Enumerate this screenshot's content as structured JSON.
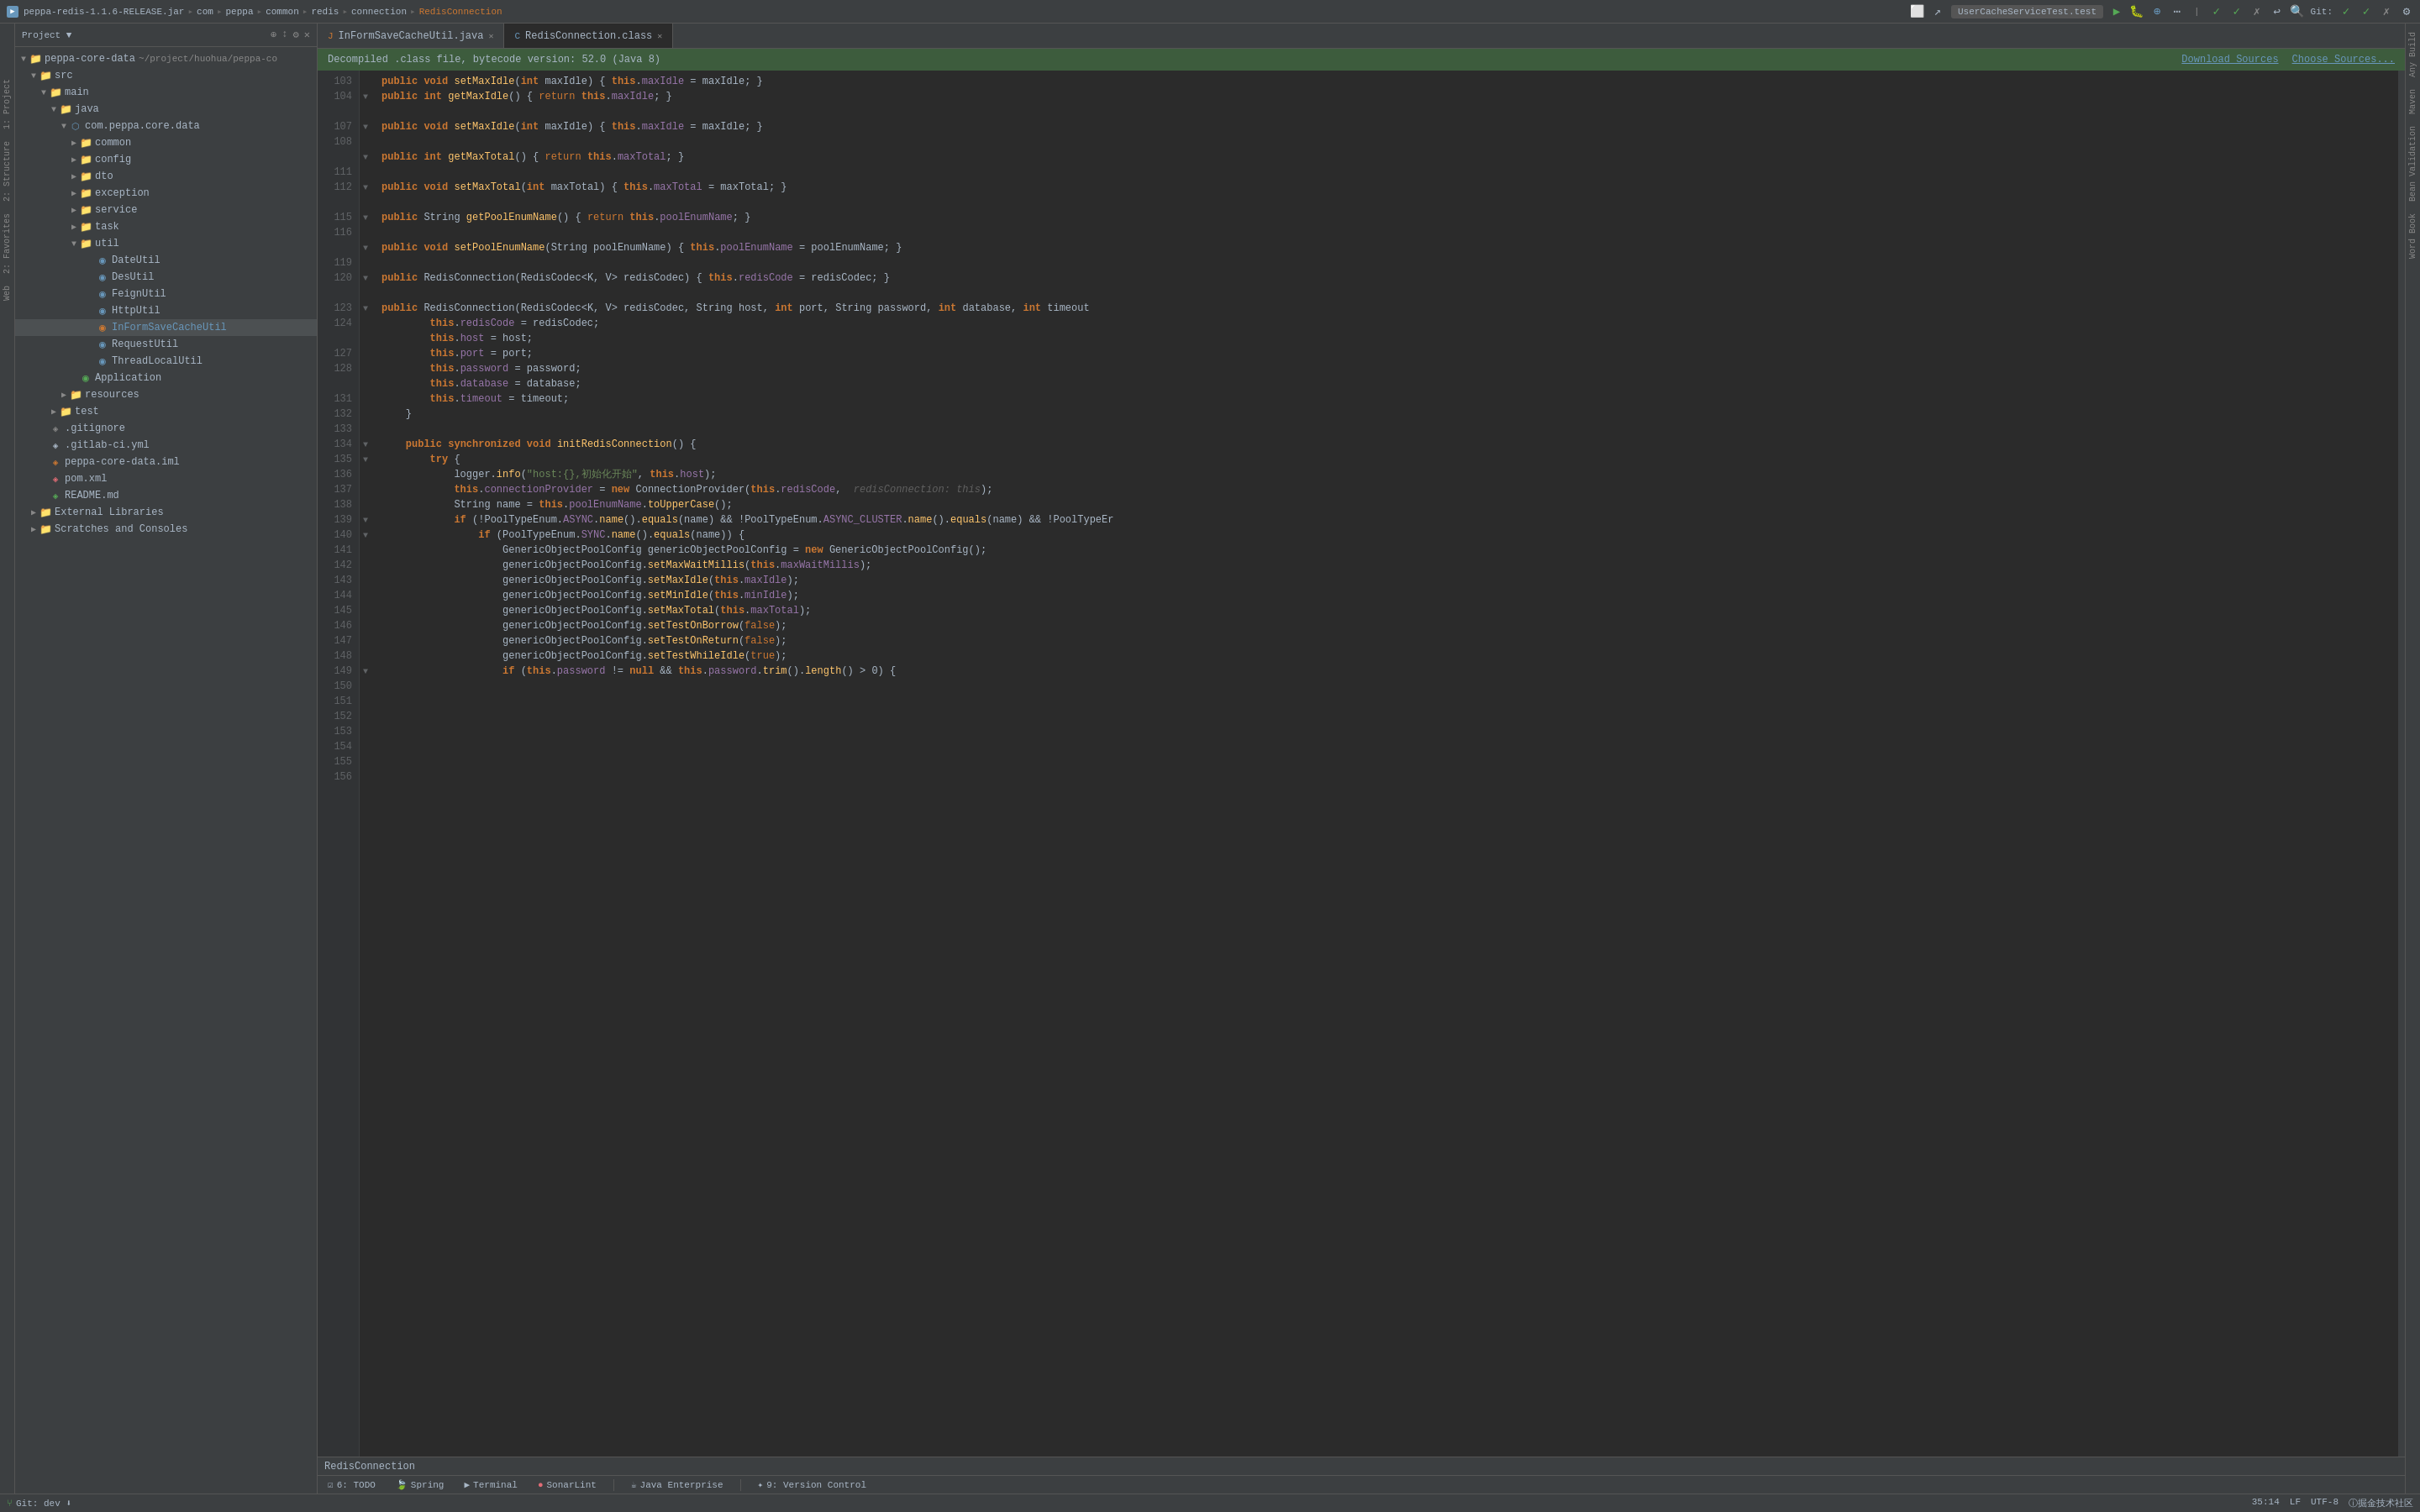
{
  "titleBar": {
    "icon": "▶",
    "breadcrumbs": [
      "peppa-redis-1.1.6-RELEASE.jar",
      "com",
      "peppa",
      "common",
      "redis",
      "connection",
      "RedisConnection"
    ],
    "runConfig": "UserCacheServiceTest.test",
    "git": "Git:"
  },
  "sidebar": {
    "title": "Project",
    "rootItem": "peppa-core-data",
    "rootPath": "~/project/huohua/peppa-co",
    "tree": [
      {
        "id": "peppa-core-data",
        "label": "peppa-core-data",
        "level": 0,
        "type": "project",
        "expanded": true,
        "arrow": "▼"
      },
      {
        "id": "src",
        "label": "src",
        "level": 1,
        "type": "folder-src",
        "expanded": true,
        "arrow": "▼"
      },
      {
        "id": "main",
        "label": "main",
        "level": 2,
        "type": "folder-main",
        "expanded": true,
        "arrow": "▼"
      },
      {
        "id": "java",
        "label": "java",
        "level": 3,
        "type": "folder",
        "expanded": true,
        "arrow": "▼"
      },
      {
        "id": "com.peppa.core.data",
        "label": "com.peppa.core.data",
        "level": 4,
        "type": "package",
        "expanded": true,
        "arrow": "▼"
      },
      {
        "id": "common",
        "label": "common",
        "level": 5,
        "type": "folder",
        "expanded": false,
        "arrow": "▶"
      },
      {
        "id": "config",
        "label": "config",
        "level": 5,
        "type": "folder",
        "expanded": false,
        "arrow": "▶"
      },
      {
        "id": "dto",
        "label": "dto",
        "level": 5,
        "type": "folder",
        "expanded": false,
        "arrow": "▶"
      },
      {
        "id": "exception",
        "label": "exception",
        "level": 5,
        "type": "folder",
        "expanded": false,
        "arrow": "▶"
      },
      {
        "id": "service",
        "label": "service",
        "level": 5,
        "type": "folder",
        "expanded": false,
        "arrow": "▶"
      },
      {
        "id": "task",
        "label": "task",
        "level": 5,
        "type": "folder",
        "expanded": false,
        "arrow": "▶"
      },
      {
        "id": "util",
        "label": "util",
        "level": 5,
        "type": "folder",
        "expanded": true,
        "arrow": "▼"
      },
      {
        "id": "DateUtil",
        "label": "DateUtil",
        "level": 6,
        "type": "class-java",
        "arrow": ""
      },
      {
        "id": "DesUtil",
        "label": "DesUtil",
        "level": 6,
        "type": "class-java",
        "arrow": ""
      },
      {
        "id": "FeignUtil",
        "label": "FeignUtil",
        "level": 6,
        "type": "class-java",
        "arrow": ""
      },
      {
        "id": "HttpUtil",
        "label": "HttpUtil",
        "level": 6,
        "type": "class-java",
        "arrow": ""
      },
      {
        "id": "InFormSaveCacheUtil",
        "label": "InFormSaveCacheUtil",
        "level": 6,
        "type": "class-active",
        "arrow": ""
      },
      {
        "id": "RequestUtil",
        "label": "RequestUtil",
        "level": 6,
        "type": "class-java",
        "arrow": ""
      },
      {
        "id": "ThreadLocalUtil",
        "label": "ThreadLocalUtil",
        "level": 6,
        "type": "class-java",
        "arrow": ""
      },
      {
        "id": "Application",
        "label": "Application",
        "level": 5,
        "type": "class-app",
        "arrow": ""
      },
      {
        "id": "resources",
        "label": "resources",
        "level": 4,
        "type": "folder",
        "expanded": false,
        "arrow": "▶"
      },
      {
        "id": "test",
        "label": "test",
        "level": 3,
        "type": "folder",
        "expanded": false,
        "arrow": "▶"
      },
      {
        "id": ".gitignore",
        "label": ".gitignore",
        "level": 2,
        "type": "gitignore",
        "arrow": ""
      },
      {
        "id": ".gitlab-ci.yml",
        "label": ".gitlab-ci.yml",
        "level": 2,
        "type": "yml",
        "arrow": ""
      },
      {
        "id": "peppa-core-data.iml",
        "label": "peppa-core-data.iml",
        "level": 2,
        "type": "iml",
        "arrow": ""
      },
      {
        "id": "pom.xml",
        "label": "pom.xml",
        "level": 2,
        "type": "xml",
        "arrow": ""
      },
      {
        "id": "README.md",
        "label": "README.md",
        "level": 2,
        "type": "md",
        "arrow": ""
      },
      {
        "id": "External Libraries",
        "label": "External Libraries",
        "level": 1,
        "type": "folder",
        "expanded": false,
        "arrow": "▶"
      },
      {
        "id": "Scratches and Consoles",
        "label": "Scratches and Consoles",
        "level": 1,
        "type": "folder",
        "expanded": false,
        "arrow": "▶"
      }
    ]
  },
  "tabs": [
    {
      "id": "inform",
      "label": "InFormSaveCacheUtil.java",
      "active": false,
      "icon": "J",
      "iconColor": "orange"
    },
    {
      "id": "redis",
      "label": "RedisConnection.class",
      "active": true,
      "icon": "C",
      "iconColor": "blue"
    }
  ],
  "infoBar": {
    "text": "Decompiled .class file, bytecode version: 52.0 (Java 8)",
    "downloadLink": "Download Sources",
    "chooseLink": "Choose Sources..."
  },
  "codeLines": [
    {
      "num": 103,
      "content": "    <kw>public</kw> <kw>void</kw> <method>setMaxIdle</method>(<type>int</type> <param>maxIdle</param>) { <this-kw>this</this-kw>.<field>maxIdle</field> = maxIdle; }",
      "fold": false
    },
    {
      "num": 104,
      "content": "    <kw>public</kw> <kw>int</kw> <method>getMaxIdle</method>() { <ret-kw>return</ret-kw> <this-kw>this</this-kw>.<field>maxIdle</field>; }",
      "fold": true
    },
    {
      "num": 107,
      "content": "",
      "fold": false
    },
    {
      "num": 108,
      "content": "    <kw>public</kw> <kw>void</kw> <method>setMaxIdle</method>(<type>int</type> <param>maxIdle</param>) { <this-kw>this</this-kw>.<field>maxIdle</field> = maxIdle; }",
      "fold": true
    },
    {
      "num": 111,
      "content": "",
      "fold": false
    },
    {
      "num": 112,
      "content": "    <kw>public</kw> <kw>int</kw> <method>getMaxTotal</method>() { <ret-kw>return</ret-kw> <this-kw>this</this-kw>.<field>maxTotal</field>; }",
      "fold": true
    },
    {
      "num": 115,
      "content": "",
      "fold": false
    },
    {
      "num": 116,
      "content": "    <kw>public</kw> <kw>void</kw> <method>setMaxTotal</method>(<type>int</type> <param>maxTotal</param>) { <this-kw>this</this-kw>.<field>maxTotal</field> = maxTotal; }",
      "fold": true
    },
    {
      "num": 119,
      "content": "",
      "fold": false
    },
    {
      "num": 120,
      "content": "    <kw>public</kw> <type>String</type> <method>getPoolEnumName</method>() { <ret-kw>return</ret-kw> <this-kw>this</this-kw>.<field>poolEnumName</field>; }",
      "fold": true
    },
    {
      "num": 123,
      "content": "",
      "fold": false
    },
    {
      "num": 124,
      "content": "    <kw>public</kw> <kw>void</kw> <method>setPoolEnumName</method>(<type>String</type> <param>poolEnumName</param>) { <this-kw>this</this-kw>.<field>poolEnumName</field> = poolEnumName; }",
      "fold": true
    },
    {
      "num": 127,
      "content": "",
      "fold": false
    },
    {
      "num": 128,
      "content": "    <kw>public</kw> <type>RedisConnection</type>(<type>RedisCodec</type>&lt;<type>K</type>, <type>V</type>&gt; <param>redisCodec</param>) { <this-kw>this</this-kw>.<field>redisCode</field> = redisCodec; }",
      "fold": true
    },
    {
      "num": 131,
      "content": "",
      "fold": false
    },
    {
      "num": 132,
      "content": "    <kw>public</kw> <type>RedisConnection</type>(<type>RedisCodec</type>&lt;<type>K</type>, <type>V</type>&gt; <param>redisCodec</param>, <type>String</type> <param>host</param>, <kw>int</kw> <param>port</param>, <type>String</type> <param>password</param>, <kw>int</kw> <param>database</param>, <kw>int</kw> <param>timeout</param>",
      "fold": true
    },
    {
      "num": 133,
      "content": "        <this-kw>this</this-kw>.<field>redisCode</field> = redisCodec;",
      "fold": false
    },
    {
      "num": 134,
      "content": "        <this-kw>this</this-kw>.<field>host</field> = host;",
      "fold": false
    },
    {
      "num": 135,
      "content": "        <this-kw>this</this-kw>.<field>port</field> = port;",
      "fold": false
    },
    {
      "num": 136,
      "content": "        <this-kw>this</this-kw>.<field>password</field> = password;",
      "fold": false
    },
    {
      "num": 137,
      "content": "        <this-kw>this</this-kw>.<field>database</field> = database;",
      "fold": false
    },
    {
      "num": 138,
      "content": "        <this-kw>this</this-kw>.<field>timeout</field> = timeout;",
      "fold": false
    },
    {
      "num": 139,
      "content": "    }",
      "fold": false
    },
    {
      "num": 140,
      "content": "",
      "fold": false
    },
    {
      "num": 141,
      "content": "    <kw>public</kw> <kw>synchronized</kw> <kw>void</kw> <method>initRedisConnection</method>() {",
      "fold": true
    },
    {
      "num": 142,
      "content": "        <kw>try</kw> {",
      "fold": true
    },
    {
      "num": 143,
      "content": "            logger.<method>info</method>(<string>\"host:{},初始化开始\"</string>, <this-kw>this</this-kw>.<field>host</field>);",
      "fold": false
    },
    {
      "num": 144,
      "content": "            <this-kw>this</this-kw>.<field>connectionProvider</field> = <new-kw>new</new-kw> <type>ConnectionProvider</type>(<this-kw>this</this-kw>.<field>redisCode</field>,   <hint>redisConnection: this</hint>);",
      "fold": false
    },
    {
      "num": 145,
      "content": "            <type>String</type> name = <this-kw>this</this-kw>.<field>poolEnumName</field>.<method>toUpperCase</method>();",
      "fold": false
    },
    {
      "num": 146,
      "content": "            <kw>if</kw> (!<type>PoolTypeEnum</type>.<field>ASYNC</field>.<method>name</method>().<method>equals</method>(name) &amp;&amp; !<type>PoolTypeEnum</type>.<field>ASYNC_CLUSTER</field>.<method>name</method>().<method>equals</method>(name) &amp;&amp; !<type>PoolTypeEr</type>",
      "fold": true
    },
    {
      "num": 147,
      "content": "                <kw>if</kw> (<type>PoolTypeEnum</type>.<field>SYNC</field>.<method>name</method>().<method>equals</method>(name)) {",
      "fold": true
    },
    {
      "num": 148,
      "content": "                    <type>GenericObjectPoolConfig</type> genericObjectPoolConfig = <new-kw>new</new-kw> <type>GenericObjectPoolConfig</type>();",
      "fold": false
    },
    {
      "num": 149,
      "content": "                    genericObjectPoolConfig.<method>setMaxWaitMillis</method>(<this-kw>this</this-kw>.<field>maxWaitMillis</field>);",
      "fold": false
    },
    {
      "num": 150,
      "content": "                    genericObjectPoolConfig.<method>setMaxIdle</method>(<this-kw>this</this-kw>.<field>maxIdle</field>);",
      "fold": false
    },
    {
      "num": 151,
      "content": "                    genericObjectPoolConfig.<method>setMinIdle</method>(<this-kw>this</this-kw>.<field>minIdle</field>);",
      "fold": false
    },
    {
      "num": 152,
      "content": "                    genericObjectPoolConfig.<method>setMaxTotal</method>(<this-kw>this</this-kw>.<field>maxTotal</field>);",
      "fold": false
    },
    {
      "num": 153,
      "content": "                    genericObjectPoolConfig.<method>setTestOnBorrow</method>(<bool-val>false</bool-val>);",
      "fold": false
    },
    {
      "num": 154,
      "content": "                    genericObjectPoolConfig.<method>setTestOnReturn</method>(<bool-val>false</bool-val>);",
      "fold": false
    },
    {
      "num": 155,
      "content": "                    genericObjectPoolConfig.<method>setTestWhileIdle</method>(<bool-val>true</bool-val>);",
      "fold": false
    },
    {
      "num": 156,
      "content": "                    <kw>if</kw> (<this-kw>this</this-kw>.<field>password</field> != <kw>null</kw> &amp;&amp; <this-kw>this</this-kw>.<field>password</field>.<method>trim</method>().<method>length</method>() &gt; 0) {",
      "fold": true
    }
  ],
  "bottomBar": {
    "fileName": "RedisConnection",
    "tabs": [
      {
        "id": "todo",
        "label": "6: TODO",
        "icon": "☑"
      },
      {
        "id": "spring",
        "label": "Spring",
        "icon": "🍃"
      },
      {
        "id": "terminal",
        "label": "Terminal",
        "icon": "▶"
      },
      {
        "id": "sonar",
        "label": "SonarLint",
        "icon": "●"
      },
      {
        "id": "java-enterprise",
        "label": "Java Enterprise",
        "icon": "☕"
      },
      {
        "id": "version-control",
        "label": "9: Version Control",
        "icon": "✦"
      }
    ]
  },
  "statusBar": {
    "position": "35:14",
    "lineEnding": "LF",
    "encoding": "UTF-8",
    "git": "Git: dev ⬇"
  },
  "rightPanels": [
    "Any Build",
    "Maven",
    "Bean Validation",
    "Word Book"
  ],
  "leftPanels": [
    "1: Project",
    "2: Structure",
    "2: Favorites",
    "Web"
  ]
}
